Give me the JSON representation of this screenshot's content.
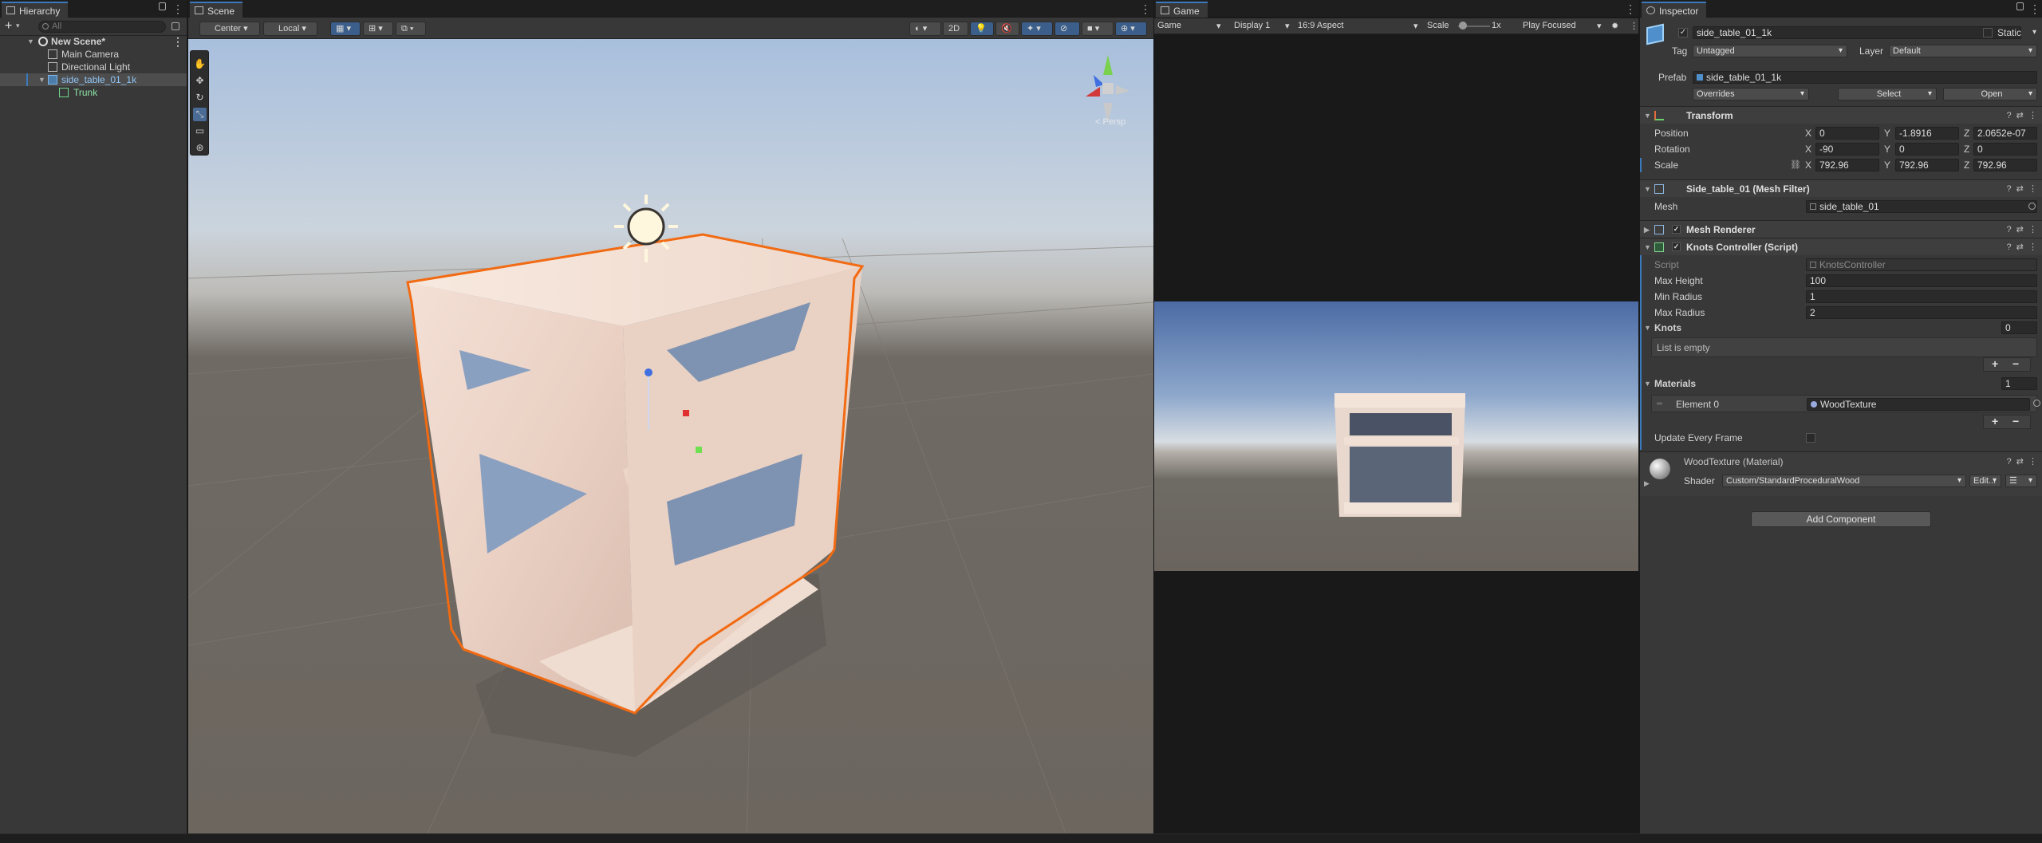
{
  "hierarchy": {
    "tab_label": "Hierarchy",
    "search_placeholder": "All",
    "items": [
      {
        "label": "New Scene*"
      },
      {
        "label": "Main Camera"
      },
      {
        "label": "Directional Light"
      },
      {
        "label": "side_table_01_1k"
      },
      {
        "label": "Trunk"
      }
    ]
  },
  "scene": {
    "tab_label": "Scene",
    "toolbar": {
      "pivot": "Center",
      "space": "Local",
      "mode_2d": "2D"
    },
    "gizmo_label": "< Persp"
  },
  "game": {
    "tab_label": "Game",
    "mode": "Game",
    "display": "Display 1",
    "aspect": "16:9 Aspect",
    "scale_label": "Scale",
    "scale_value": "1x",
    "play_focused": "Play Focused"
  },
  "inspector": {
    "tab_label": "Inspector",
    "object_name": "side_table_01_1k",
    "static_label": "Static",
    "tag_label": "Tag",
    "tag_value": "Untagged",
    "layer_label": "Layer",
    "layer_value": "Default",
    "prefab_label": "Prefab",
    "prefab_value": "side_table_01_1k",
    "overrides": "Overrides",
    "select": "Select",
    "open": "Open",
    "transform": {
      "title": "Transform",
      "position_label": "Position",
      "rotation_label": "Rotation",
      "scale_label": "Scale",
      "position": {
        "x": "0",
        "y": "-1.8916",
        "z": "2.0652e-07"
      },
      "rotation": {
        "x": "-90",
        "y": "0",
        "z": "0"
      },
      "scale": {
        "x": "792.96",
        "y": "792.96",
        "z": "792.96"
      }
    },
    "mesh_filter": {
      "title": "Side_table_01 (Mesh Filter)",
      "mesh_label": "Mesh",
      "mesh_value": "side_table_01"
    },
    "mesh_renderer": {
      "title": "Mesh Renderer"
    },
    "knots_controller": {
      "title": "Knots Controller (Script)",
      "script_label": "Script",
      "script_value": "KnotsController",
      "max_height_label": "Max Height",
      "max_height": "100",
      "min_radius_label": "Min Radius",
      "min_radius": "1",
      "max_radius_label": "Max Radius",
      "max_radius": "2",
      "knots_label": "Knots",
      "knots_count": "0",
      "list_empty": "List is empty",
      "materials_label": "Materials",
      "materials_count": "1",
      "element0_label": "Element 0",
      "element0_value": "WoodTexture",
      "update_every_frame_label": "Update Every Frame"
    },
    "material": {
      "title": "WoodTexture (Material)",
      "shader_label": "Shader",
      "shader_value": "Custom/StandardProceduralWood",
      "edit": "Edit..."
    },
    "add_component": "Add Component"
  },
  "colors": {
    "selection_outline": "#f26a12",
    "panel_bg": "#383838",
    "accent_blue": "#3a79bb"
  }
}
